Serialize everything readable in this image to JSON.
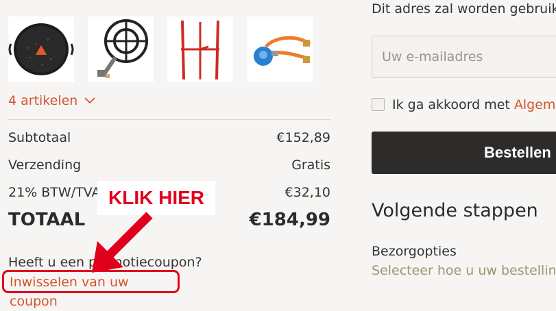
{
  "cart": {
    "products": [
      {
        "icon": "paella-pan-icon"
      },
      {
        "icon": "gas-burner-icon"
      },
      {
        "icon": "burner-stand-icon"
      },
      {
        "icon": "gas-regulator-hose-icon"
      }
    ],
    "items_toggle": "4 artikelen",
    "rows": [
      {
        "label": "Subtotaal",
        "value": "€152,89"
      },
      {
        "label": "Verzending",
        "value": "Gratis"
      },
      {
        "label": "21% BTW/TVA",
        "value": "€32,10"
      }
    ],
    "total": {
      "label": "TOTAAL",
      "value": "€184,99"
    },
    "coupon": {
      "question": "Heeft u een promotiecoupon?",
      "link": "Inwisselen van uw coupon"
    }
  },
  "annotation": {
    "callout": "KLIK HIER",
    "color": "#e1001b"
  },
  "checkout": {
    "notice": "Dit adres zal worden gebruikt",
    "email_placeholder": "Uw e-mailadres",
    "agree_prefix": "Ik ga akkoord met ",
    "agree_link": "Algemene",
    "order_button": "Bestellen",
    "next_steps_title": "Volgende stappen",
    "delivery_label": "Bezorgopties",
    "delivery_hint": "Selecteer hoe u uw bestelling"
  },
  "colors": {
    "accent": "#d2542e",
    "background": "#f7f5f3",
    "button": "#2e2c2b"
  }
}
